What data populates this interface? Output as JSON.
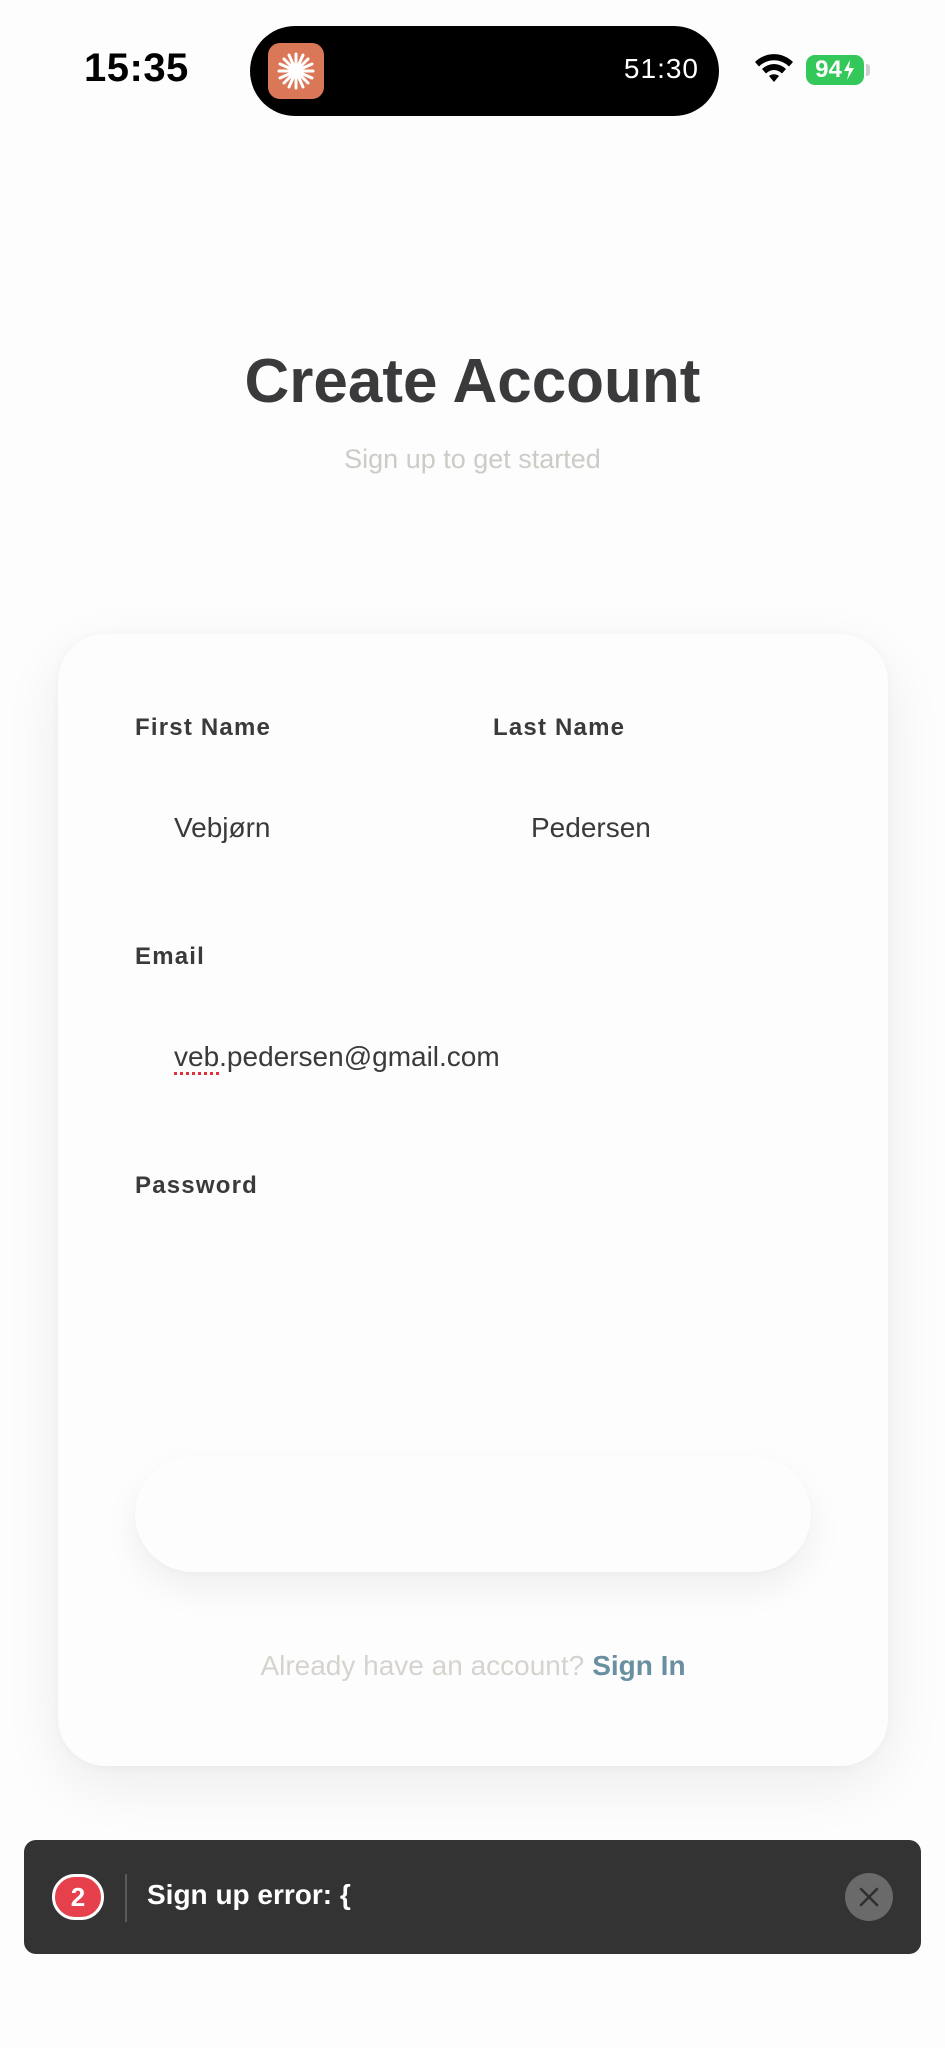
{
  "status_bar": {
    "time": "15:35",
    "timer": "51:30",
    "battery": "94",
    "app_icon": "claude-icon",
    "wifi_icon": "wifi-icon",
    "battery_icon": "battery-charging-icon"
  },
  "header": {
    "title": "Create Account",
    "subtitle": "Sign up to get started"
  },
  "form": {
    "first_name": {
      "label": "First Name",
      "value": "Vebjørn"
    },
    "last_name": {
      "label": "Last Name",
      "value": "Pedersen"
    },
    "email": {
      "label": "Email",
      "value_flagged": "veb",
      "value_rest": ".pedersen@gmail.com"
    },
    "password": {
      "label": "Password",
      "value": ""
    },
    "submit_label": ""
  },
  "footer": {
    "prompt": "Already have an account?",
    "link": "Sign In"
  },
  "toast": {
    "count": "2",
    "message": "Sign up error: {",
    "close_icon": "close-icon"
  },
  "colors": {
    "accent_link": "#6a8fa0",
    "badge": "#e5404c",
    "toast_bg": "#333333",
    "battery": "#34c759",
    "app_icon": "#d97757"
  }
}
